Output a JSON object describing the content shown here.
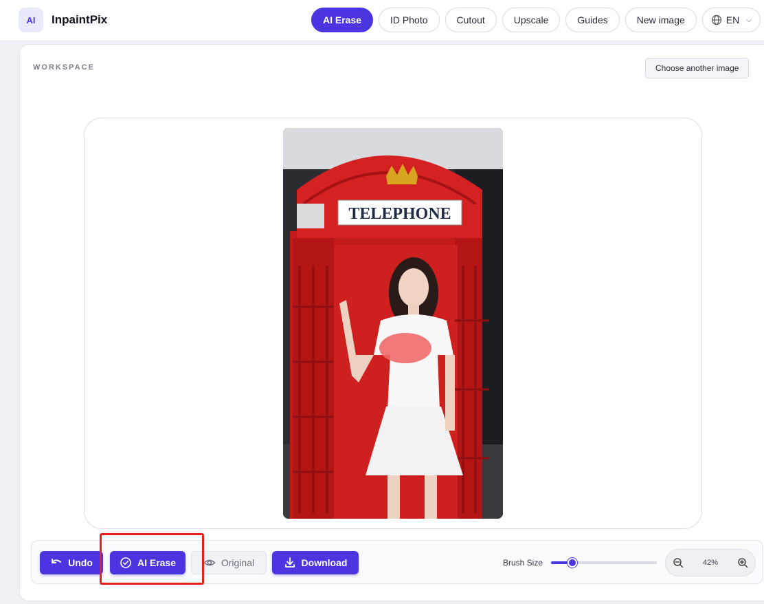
{
  "brand": {
    "badge": "AI",
    "name": "InpaintPix"
  },
  "nav": {
    "items": [
      {
        "label": "AI Erase",
        "active": true
      },
      {
        "label": "ID Photo",
        "active": false
      },
      {
        "label": "Cutout",
        "active": false
      },
      {
        "label": "Upscale",
        "active": false
      },
      {
        "label": "Guides",
        "active": false
      },
      {
        "label": "New image",
        "active": false
      }
    ],
    "language": "EN"
  },
  "workspace": {
    "label": "WORKSPACE",
    "choose_button": "Choose another image"
  },
  "photo": {
    "sign_text": "TELEPHONE",
    "description_icon": "image-preview"
  },
  "toolbar": {
    "undo_label": "Undo",
    "erase_label": "AI Erase",
    "original_label": "Original",
    "download_label": "Download",
    "brush_label": "Brush Size",
    "brush_value_fraction": 0.2,
    "zoom_value": "42%"
  },
  "colors": {
    "accent": "#4b35e0",
    "highlight": "#e8201c"
  }
}
